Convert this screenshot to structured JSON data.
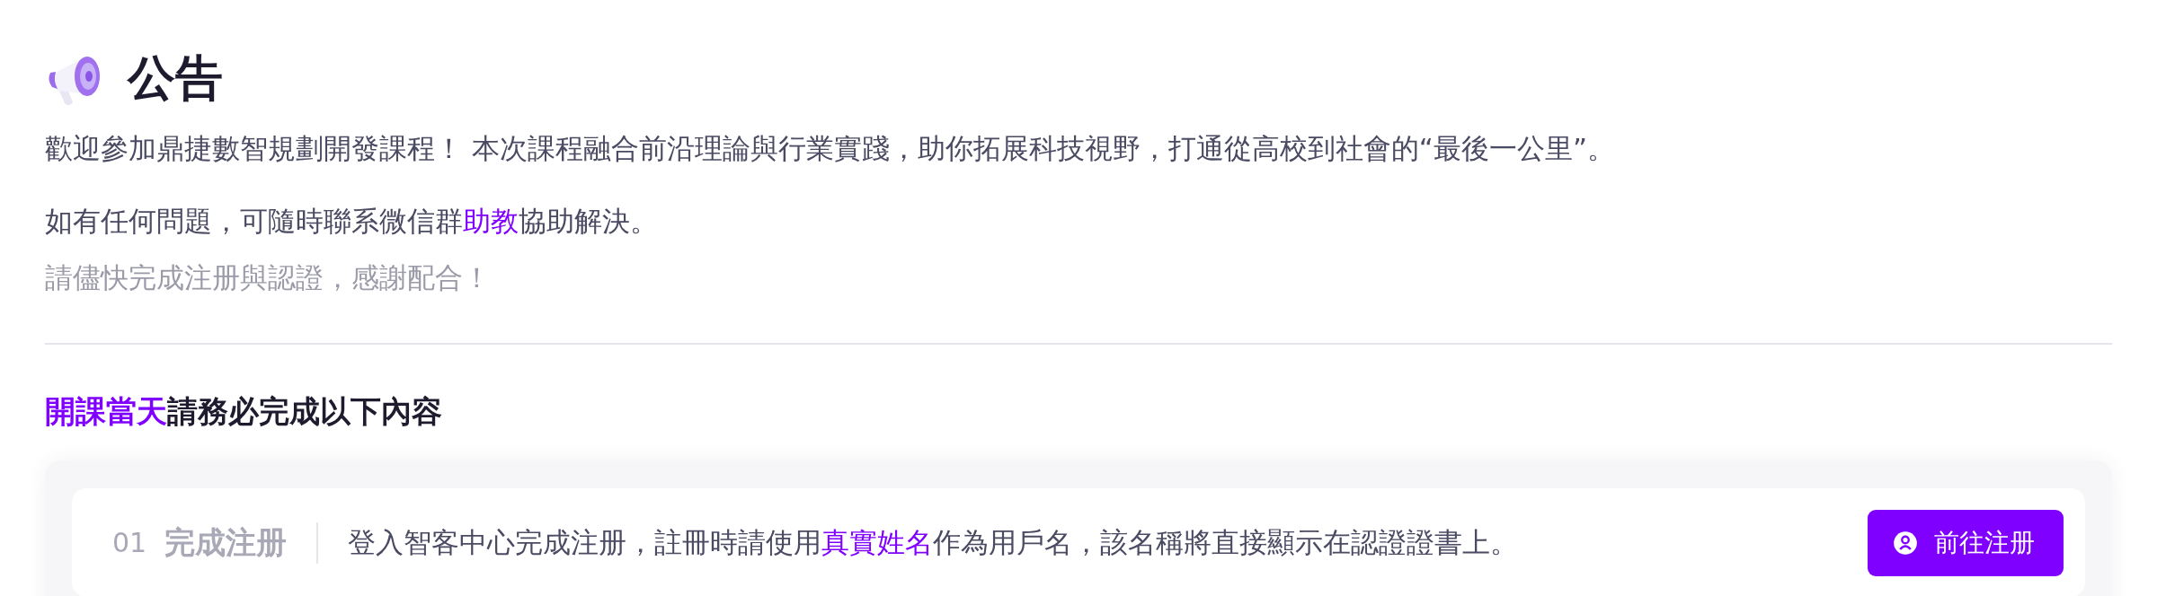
{
  "announcement": {
    "title": "公告",
    "paragraphs": [
      {
        "kind": "normal",
        "segments": [
          {
            "text": "歡迎參加鼎捷數智規劃開發課程！  本次課程融合前沿理論與行業實踐，助你拓展科技視野，打通從高校到社會的“最後一公里”。",
            "highlight": false
          }
        ]
      },
      {
        "kind": "normal",
        "segments": [
          {
            "text": "如有任何問題，可隨時聯系微信群",
            "highlight": false
          },
          {
            "text": "助教",
            "highlight": true
          },
          {
            "text": "協助解決。",
            "highlight": false
          }
        ]
      },
      {
        "kind": "muted",
        "segments": [
          {
            "text": "請儘快完成注册與認證，感謝配合！",
            "highlight": false
          }
        ]
      }
    ]
  },
  "tasks": {
    "heading": [
      {
        "text": "開課當天",
        "highlight": true
      },
      {
        "text": "請務必完成以下內容",
        "highlight": false
      }
    ],
    "steps": [
      {
        "number": "01",
        "title": "完成注册",
        "description": [
          {
            "text": "登入智客中心完成注册，註冊時請使用",
            "highlight": false
          },
          {
            "text": "真實姓名",
            "highlight": true
          },
          {
            "text": "作為用戶名，該名稱將直接顯示在認證證書上。",
            "highlight": false
          }
        ],
        "button": "前往注册"
      }
    ]
  }
}
